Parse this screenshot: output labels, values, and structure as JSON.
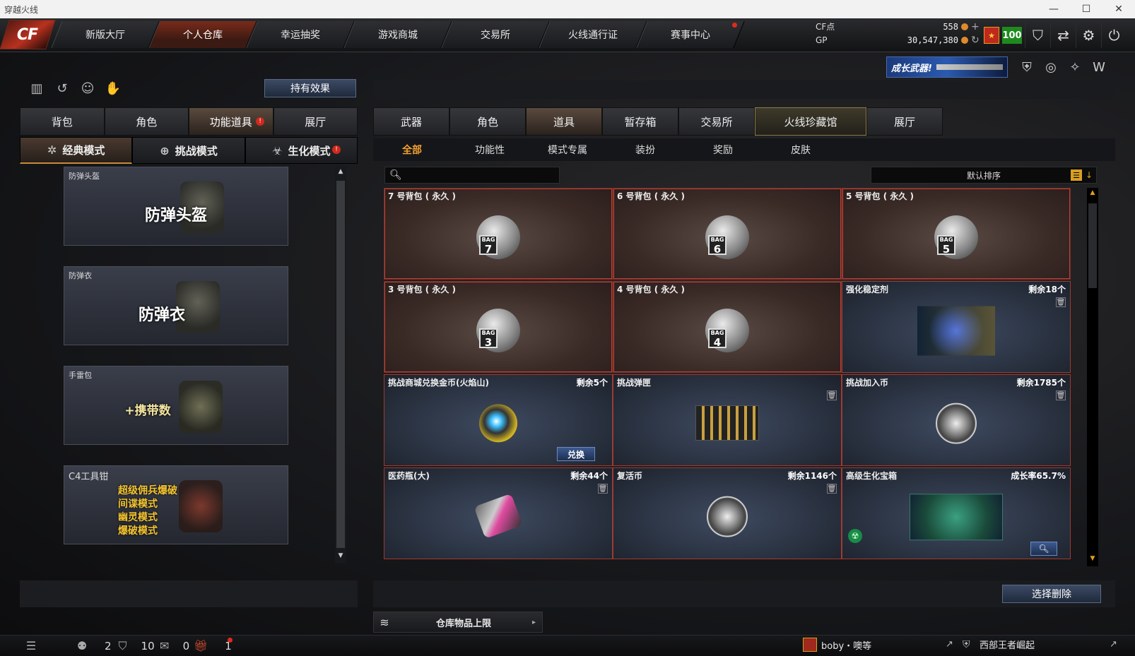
{
  "window": {
    "title": "穿越火线",
    "minimize": "—",
    "maximize": "☐",
    "close": "✕"
  },
  "logo_text": "CF",
  "nav": {
    "tabs": [
      "新版大厅",
      "个人仓库",
      "幸运抽奖",
      "游戏商城",
      "交易所",
      "火线通行证",
      "赛事中心"
    ],
    "active_index": 1
  },
  "currency": {
    "cf_label": "CF点",
    "cf_value": "558",
    "gp_label": "GP",
    "gp_value": "30,547,380",
    "level_value": "100"
  },
  "growth_banner": "成长武器!",
  "left": {
    "hold_effect_button": "持有效果",
    "tabs": [
      "背包",
      "角色",
      "功能道具",
      "展厅"
    ],
    "active_tab_index": 2,
    "mode_tabs": [
      "经典模式",
      "挑战模式",
      "生化模式"
    ],
    "active_mode_index": 0,
    "items": [
      {
        "title": "防弹头盔",
        "big": "防弹头盔"
      },
      {
        "title": "防弹衣",
        "big": "防弹衣"
      },
      {
        "title": "手雷包",
        "big": "+携带数"
      },
      {
        "title": "C4工具钳",
        "lines": [
          "超级佣兵爆破",
          "间谍模式",
          "幽灵模式",
          "爆破模式"
        ]
      }
    ]
  },
  "right": {
    "tabs": [
      "武器",
      "角色",
      "道具",
      "暂存箱",
      "交易所",
      "火线珍藏馆",
      "展厅"
    ],
    "active_tab_index": 2,
    "filters": [
      "全部",
      "功能性",
      "模式专属",
      "装扮",
      "奖励",
      "皮肤"
    ],
    "active_filter_index": 0,
    "search_placeholder": "",
    "sort_label": "默认排序",
    "items": [
      {
        "title": "7 号背包 ( 永久 )",
        "bag": "7",
        "bag_word": "BAG",
        "style": "brown"
      },
      {
        "title": "6 号背包 ( 永久 )",
        "bag": "6",
        "bag_word": "BAG",
        "style": "brown"
      },
      {
        "title": "5 号背包 ( 永久 )",
        "bag": "5",
        "bag_word": "BAG",
        "style": "brown"
      },
      {
        "title": "3 号背包 ( 永久 )",
        "bag": "3",
        "bag_word": "BAG",
        "style": "brown"
      },
      {
        "title": "4 号背包 ( 永久 )",
        "bag": "4",
        "bag_word": "BAG",
        "style": "brown"
      },
      {
        "title": "强化稳定剂",
        "right": "剩余18个",
        "style": "blue"
      },
      {
        "title": "挑战商城兑换金币(火焰山)",
        "right": "剩余5个",
        "style": "blue",
        "button": "兑换"
      },
      {
        "title": "挑战弹匣",
        "right": "",
        "style": "blue"
      },
      {
        "title": "挑战加入币",
        "right": "剩余1785个",
        "style": "blue"
      },
      {
        "title": "医药瓶(大)",
        "right": "剩余44个",
        "style": "blue"
      },
      {
        "title": "复活币",
        "right": "剩余1146个",
        "style": "blue"
      },
      {
        "title": "高级生化宝箱",
        "right": "成长率65.7%",
        "style": "blue"
      }
    ],
    "delete_button": "选择删除",
    "limit_label": "仓库物品上限"
  },
  "status": {
    "count1": "2",
    "count2": "10",
    "count3": "0",
    "count4": "1",
    "user_name": "boby・噢等",
    "clan_name": "西部王者崛起"
  }
}
